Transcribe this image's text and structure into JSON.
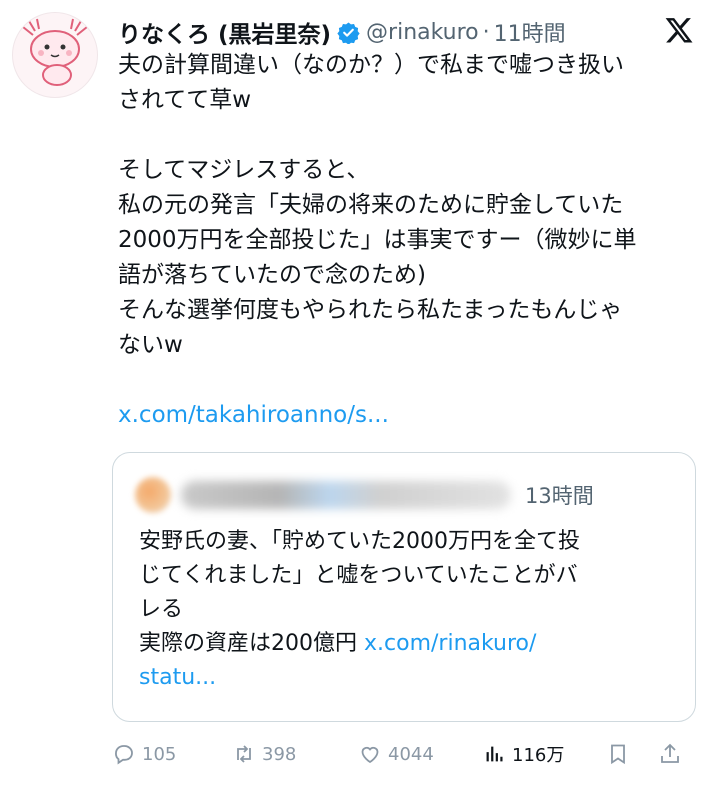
{
  "author": {
    "display_name": "りなくろ (黒岩里奈)",
    "handle": "@rinakuro",
    "separator": "·",
    "time": "11時間"
  },
  "tweet_lines": [
    "夫の計算間違い（なのか？）で私まで嘘つき扱い",
    "されてて草w",
    "",
    "そしてマジレスすると、",
    "私の元の発言「夫婦の将来のために貯金していた",
    "2000万円を全部投じた」は事実ですー（微妙に単",
    "語が落ちていたので念のため)",
    "そんな選挙何度もやられたら私たまったもんじゃ",
    "ないw",
    ""
  ],
  "tweet_link": "x.com/takahiroanno/s...",
  "quote": {
    "time": "13時間",
    "lines": [
      "安野氏の妻、「貯めていた2000万円を全て投",
      "じてくれました」と嘘をついていたことがバ",
      "レる"
    ],
    "last_line_text": "実際の資産は200億円 ",
    "link_part1": "x.com/rinakuro/",
    "link_part2": "statu..."
  },
  "actions": {
    "replies": "105",
    "reposts": "398",
    "likes": "4044",
    "views": "116万"
  },
  "colors": {
    "link": "#1d9bf0",
    "verified": "#1d9bf0",
    "muted": "#536471"
  },
  "icons": [
    "axolotl-avatar",
    "verified-badge-icon",
    "x-logo-icon",
    "reply-icon",
    "repost-icon",
    "like-icon",
    "views-icon",
    "bookmark-icon",
    "share-icon"
  ]
}
